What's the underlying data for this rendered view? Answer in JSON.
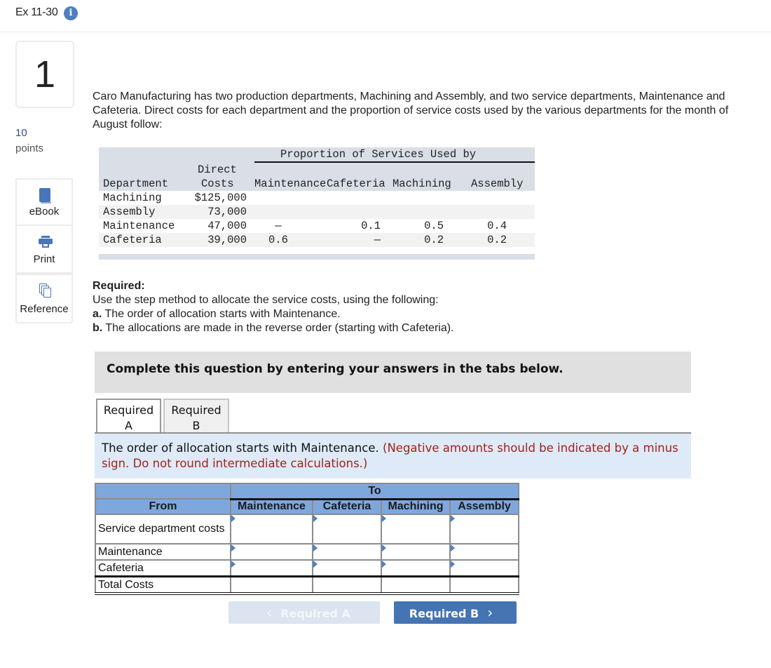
{
  "header": {
    "title": "Ex 11-30",
    "info_icon": "i"
  },
  "question": {
    "number": "1",
    "points_value": "10",
    "points_label": "points"
  },
  "tools": [
    {
      "label": "eBook",
      "icon": "book-icon"
    },
    {
      "label": "Print",
      "icon": "printer-icon"
    },
    {
      "label": "Reference",
      "icon": "copy-icon"
    }
  ],
  "intro_text": "Caro Manufacturing has two production departments, Machining and Assembly, and two service departments, Maintenance and Cafeteria. Direct costs for each department and the proportion of service costs used by the various departments for the month of August follow:",
  "data_table": {
    "group_header": "Proportion of Services Used by",
    "headers": {
      "department": "Department",
      "direct_line1": "Direct",
      "direct_line2": "Costs",
      "maintenance": "Maintenance",
      "cafeteria": "Cafeteria",
      "machining": "Machining",
      "assembly": "Assembly"
    },
    "rows": [
      {
        "department": "Machining",
        "direct_costs": "$125,000",
        "maintenance": "",
        "cafeteria": "",
        "machining": "",
        "assembly": ""
      },
      {
        "department": "Assembly",
        "direct_costs": "73,000",
        "maintenance": "",
        "cafeteria": "",
        "machining": "",
        "assembly": ""
      },
      {
        "department": "Maintenance",
        "direct_costs": "47,000",
        "maintenance": "—",
        "cafeteria": "0.1",
        "machining": "0.5",
        "assembly": "0.4"
      },
      {
        "department": "Cafeteria",
        "direct_costs": "39,000",
        "maintenance": "0.6",
        "cafeteria": "—",
        "machining": "0.2",
        "assembly": "0.2"
      }
    ]
  },
  "required": {
    "heading": "Required:",
    "intro": "Use the step method to allocate the service costs, using the following:",
    "items": [
      {
        "marker": "a.",
        "text": " The order of allocation starts with Maintenance."
      },
      {
        "marker": "b.",
        "text": " The allocations are made in the reverse order (starting with Cafeteria)."
      }
    ]
  },
  "complete_banner": "Complete this question by entering your answers in the tabs below.",
  "tabs": [
    {
      "line1": "Required",
      "line2": "A",
      "active": true
    },
    {
      "line1": "Required",
      "line2": "B",
      "active": false
    }
  ],
  "instructions": {
    "main": "The order of allocation starts with Maintenance. ",
    "note": "(Negative amounts should be indicated by a minus sign. Do not round intermediate calculations.)"
  },
  "answer_table": {
    "to_header": "To",
    "from_header": "From",
    "columns": [
      "Maintenance",
      "Cafeteria",
      "Machining",
      "Assembly"
    ],
    "rows": [
      {
        "label": "Service department costs",
        "values": [
          "",
          "",
          "",
          ""
        ]
      },
      {
        "label": "Maintenance",
        "values": [
          "",
          "",
          "",
          ""
        ]
      },
      {
        "label": "Cafeteria",
        "values": [
          "",
          "",
          "",
          ""
        ]
      },
      {
        "label": "Total Costs",
        "values": [
          "",
          "",
          "",
          ""
        ]
      }
    ]
  },
  "nav": {
    "prev_label": "Required A",
    "next_label": "Required B",
    "prev_icon": "‹",
    "next_icon": "›",
    "prev_disabled": true
  },
  "colors": {
    "accent": "#4574b3",
    "table_header": "#7ea7dd",
    "note_red": "#a1221a",
    "instructions_bg": "#deeaf7"
  }
}
